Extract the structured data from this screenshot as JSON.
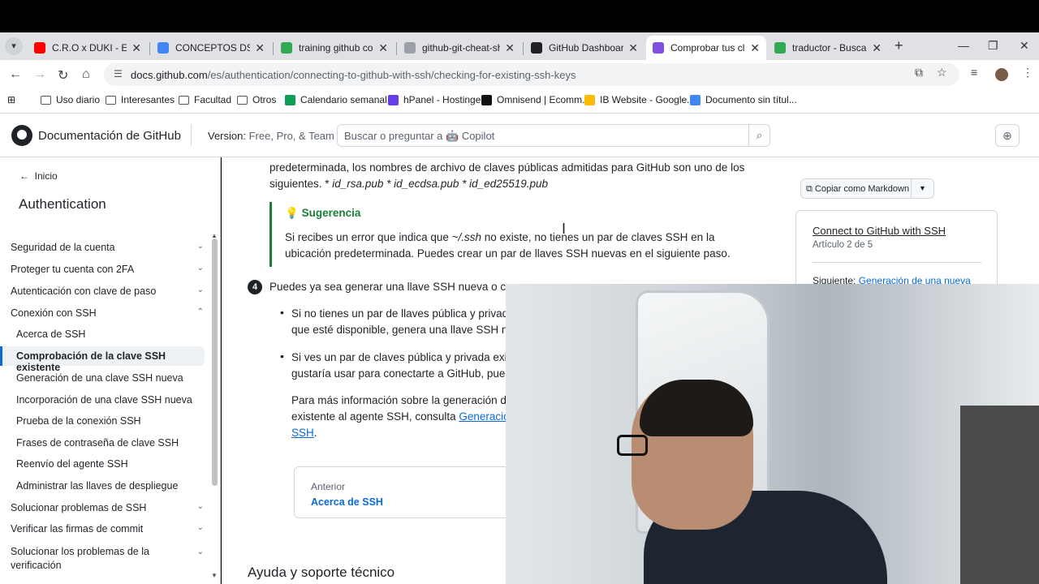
{
  "browser": {
    "tabs": [
      {
        "title": "C.R.O x DUKI - El",
        "favicon_color": "#ff0000",
        "active": false
      },
      {
        "title": "CONCEPTOS DSW (y",
        "favicon_color": "#4285f4",
        "active": false
      },
      {
        "title": "training github com",
        "favicon_color": "#34a853",
        "active": false
      },
      {
        "title": "github-git-cheat-she",
        "favicon_color": "#9aa0a6",
        "active": false
      },
      {
        "title": "GitHub Dashboard",
        "favicon_color": "#202124",
        "active": false
      },
      {
        "title": "Comprobar tus clave",
        "favicon_color": "#8250df",
        "active": true
      },
      {
        "title": "traductor - Buscar co",
        "favicon_color": "#34a853",
        "active": false
      }
    ],
    "url_host": "docs.github.com",
    "url_path": "/es/authentication/connecting-to-github-with-ssh/checking-for-existing-ssh-keys",
    "bookmarks": [
      {
        "label": "Uso diario",
        "kind": "folder"
      },
      {
        "label": "Interesantes",
        "kind": "folder"
      },
      {
        "label": "Facultad",
        "kind": "folder"
      },
      {
        "label": "Otros",
        "kind": "folder"
      },
      {
        "label": "Calendario semanal...",
        "kind": "site",
        "color": "#0f9d58"
      },
      {
        "label": "hPanel - Hostinger",
        "kind": "site",
        "color": "#673de6"
      },
      {
        "label": "Omnisend | Ecomm...",
        "kind": "site",
        "color": "#111111"
      },
      {
        "label": "IB Website - Google...",
        "kind": "site",
        "color": "#fbbc04"
      },
      {
        "label": "Documento sin títul...",
        "kind": "site",
        "color": "#4285f4"
      }
    ]
  },
  "header": {
    "title": "Documentación de GitHub",
    "version_label": "Version:",
    "version_value": "Free, Pro, & Team",
    "search_placeholder": "Buscar o preguntar a 🤖 Copilot"
  },
  "sidebar": {
    "home": "Inicio",
    "section": "Authentication",
    "items": [
      {
        "label": "Seguridad de la cuenta",
        "chevron": "down"
      },
      {
        "label": "Proteger tu cuenta con 2FA",
        "chevron": "down"
      },
      {
        "label": "Autenticación con clave de paso",
        "chevron": "down"
      },
      {
        "label": "Conexión con SSH",
        "chevron": "up"
      }
    ],
    "subitems": [
      "Acerca de SSH",
      "Comprobación de la clave SSH existente",
      "Generación de una clave SSH nueva",
      "Incorporación de una clave SSH nueva",
      "Prueba de la conexión SSH",
      "Frases de contraseña de clave SSH",
      "Reenvío del agente SSH",
      "Administrar las llaves de despliegue"
    ],
    "items_after": [
      {
        "label": "Solucionar problemas de SSH"
      },
      {
        "label": "Verificar las firmas de commit"
      },
      {
        "label": "Solucionar los problemas de la verificación"
      }
    ]
  },
  "content": {
    "para1_line1": "predeterminada, los nombres de archivo de claves públicas admitidas para GitHub son uno de los",
    "para1_line2_a": "siguientes. * ",
    "para1_line2_b": "id_rsa.pub * id_ecdsa.pub * id_ed25519.pub",
    "tip_heading": "Sugerencia",
    "tip_text_a": "Si recibes un error que indica que ",
    "tip_text_code": "~/.ssh",
    "tip_text_b": " no existe, no tienes un par de claves SSH en la ubicación predeterminada. Puedes crear un par de llaves SSH nuevas en el siguiente paso.",
    "step_number": "4",
    "step_text": "Puedes ya sea generar una llave SSH nueva o carg",
    "bullet1_line1": "Si no tienes un par de llaves pública y privad",
    "bullet1_line2": "que esté disponible, genera una llave SSH nu",
    "bullet2_line1": "Si ves un par de claves pública y privada exist",
    "bullet2_line2": "gustaría usar para conectarte a GitHub, pued",
    "more_line1": "Para más información sobre la generación de",
    "more_line2_a": "existente al agente SSH, consulta ",
    "more_line2_link": "Generación",
    "more_line3_link": "SSH",
    "more_line3_b": ".",
    "prev_label": "Anterior",
    "prev_value": "Acerca de SSH",
    "help_heading": "Ayuda y soporte técnico"
  },
  "aside": {
    "copy_label": "Copiar como Markdown",
    "toc_title": "Connect to GitHub with SSH",
    "toc_article": "Artículo 2 de 5",
    "toc_next_label": "Siguiente:",
    "toc_next_link": "Generación de una nueva"
  }
}
